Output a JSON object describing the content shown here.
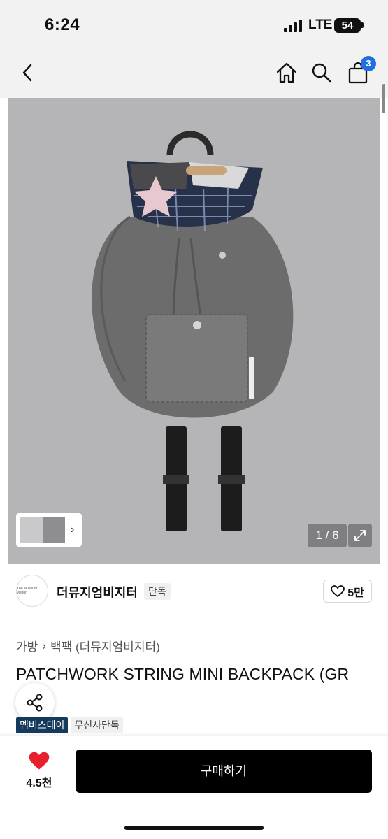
{
  "status_bar": {
    "time": "6:24",
    "network": "LTE",
    "battery": "54"
  },
  "nav": {
    "cart_count": "3"
  },
  "gallery": {
    "counter": "1 / 6"
  },
  "brand": {
    "logo_text": "The Museum Visitor",
    "name": "더뮤지엄비지터",
    "tag": "단독",
    "likes": "5만"
  },
  "breadcrumb": {
    "category": "가방",
    "subcategory": "백팩 (더뮤지엄비지터)"
  },
  "product": {
    "title": "PATCHWORK STRING MINI BACKPACK (GR",
    "badges": [
      "멤버스데이",
      "무신사단독"
    ]
  },
  "bottom_bar": {
    "wish_count": "4.5천",
    "buy_label": "구매하기"
  },
  "colors": {
    "accent": "#1f6fe0",
    "wish": "#e8202e",
    "badge_dark": "#163a5c",
    "buy_button": "#000000",
    "image_bg": "#b5b5b7"
  }
}
